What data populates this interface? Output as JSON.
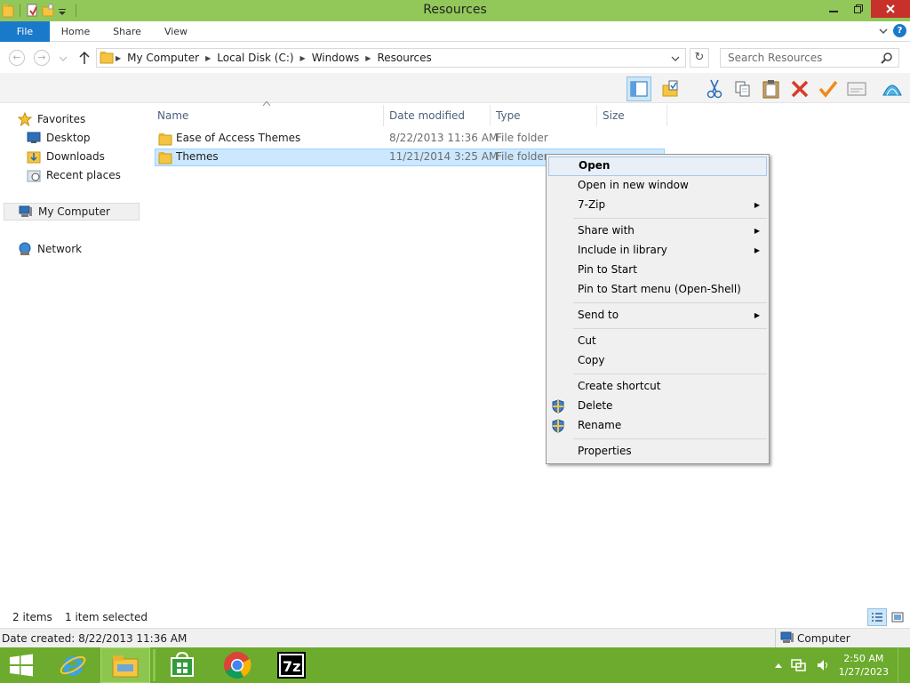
{
  "window": {
    "title": "Resources"
  },
  "ribbon": {
    "tabs": [
      "File",
      "Home",
      "Share",
      "View"
    ]
  },
  "address": {
    "crumbs": [
      "My Computer",
      "Local Disk (C:)",
      "Windows",
      "Resources"
    ],
    "search_placeholder": "Search Resources"
  },
  "nav": {
    "favorites": "Favorites",
    "desktop": "Desktop",
    "downloads": "Downloads",
    "recent": "Recent places",
    "computer": "My Computer",
    "network": "Network"
  },
  "columns": {
    "name": "Name",
    "date": "Date modified",
    "type": "Type",
    "size": "Size"
  },
  "files": [
    {
      "name": "Ease of Access Themes",
      "date": "8/22/2013 11:36 AM",
      "type": "File folder"
    },
    {
      "name": "Themes",
      "date": "11/21/2014 3:25 AM",
      "type": "File folder"
    }
  ],
  "context_menu": {
    "open": "Open",
    "open_new_window": "Open in new window",
    "zip": "7-Zip",
    "share_with": "Share with",
    "include_library": "Include in library",
    "pin_start": "Pin to Start",
    "pin_start_menu": "Pin to Start menu (Open-Shell)",
    "send_to": "Send to",
    "cut": "Cut",
    "copy": "Copy",
    "create_shortcut": "Create shortcut",
    "delete": "Delete",
    "rename": "Rename",
    "properties": "Properties"
  },
  "status": {
    "items": "2 items",
    "selected": "1 item selected"
  },
  "details": {
    "date_created": "Date created: 8/22/2013 11:36 AM",
    "location": "Computer"
  },
  "taskbar": {
    "time": "2:50 AM",
    "date": "1/27/2023"
  },
  "colors": {
    "accent": "#1979ca",
    "titlebar": "#92c85a",
    "taskbar": "#6cab2e",
    "selection": "#cce8ff"
  }
}
